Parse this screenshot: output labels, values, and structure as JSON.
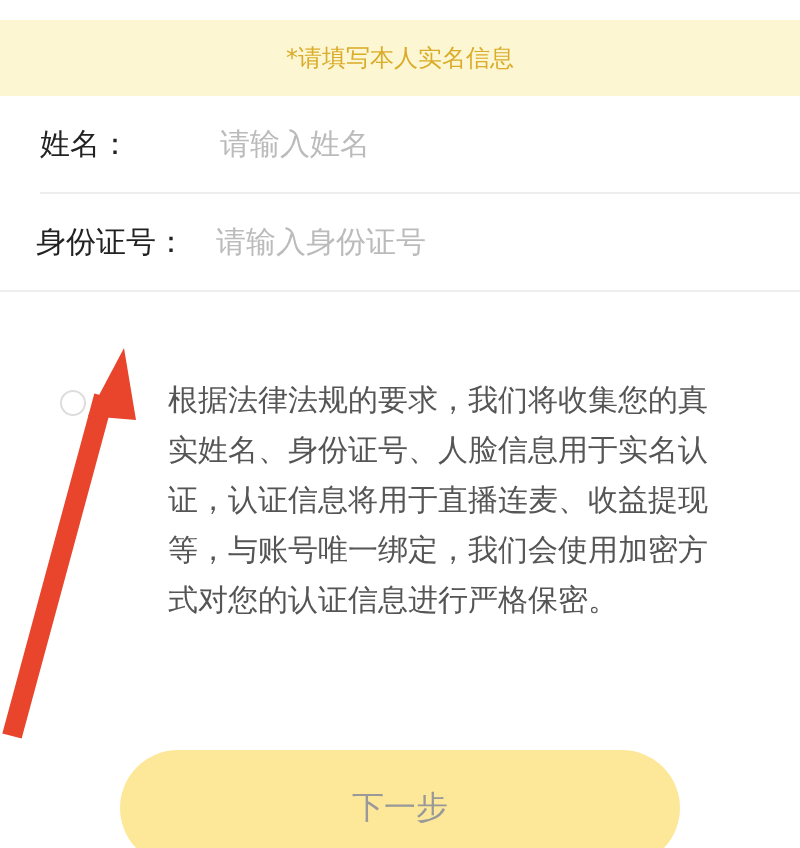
{
  "notice": "*请填写本人实名信息",
  "fields": [
    {
      "label": "姓名：",
      "placeholder": "请输入姓名"
    },
    {
      "label": "身份证号：",
      "placeholder": "请输入身份证号"
    }
  ],
  "agreement": {
    "checked": false,
    "text": "根据法律法规的要求，我们将收集您的真实姓名、身份证号、人脸信息用于实名认证，认证信息将用于直播连麦、收益提现等，与账号唯一绑定，我们会使用加密方式对您的认证信息进行严格保密。"
  },
  "next_button": {
    "label": "下一步",
    "disabled": true
  }
}
